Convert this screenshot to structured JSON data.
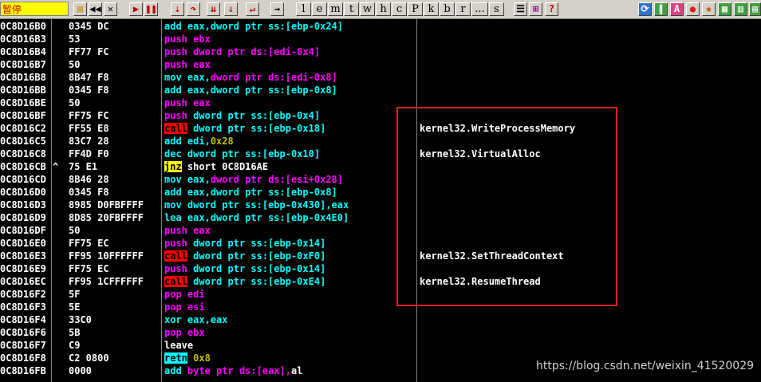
{
  "toolbar": {
    "status": "暂停",
    "letters": [
      "l",
      "e",
      "m",
      "t",
      "w",
      "h",
      "c",
      "P",
      "k",
      "b",
      "r",
      "...",
      "s"
    ],
    "help": "?",
    "icons": [
      "open-icon",
      "rewind-icon",
      "close-icon",
      "run-icon",
      "pause-icon",
      "step-into-icon",
      "step-over-icon",
      "trace-into-icon",
      "trace-over-icon",
      "execute-till-return-icon",
      "goto-icon",
      "list-icon",
      "windows-icon",
      "refresh-icon",
      "plugin-icon",
      "a-icon",
      "record-icon",
      "settings-icon",
      "grid-icon",
      "options-icon"
    ]
  },
  "rows": [
    {
      "addr": "0C8D16B0",
      "mark": "",
      "hex": "0345 DC",
      "mnem": "add",
      "kind": "k-mov",
      "ops": [
        [
          "eax,dword ptr ss:[ebp-0x24]",
          "op-cyan"
        ]
      ],
      "comment": ""
    },
    {
      "addr": "0C8D16B3",
      "mark": "",
      "hex": "53",
      "mnem": "push",
      "kind": "k-push",
      "ops": [
        [
          "ebx",
          "op-mag"
        ]
      ],
      "comment": ""
    },
    {
      "addr": "0C8D16B4",
      "mark": "",
      "hex": "FF77 FC",
      "mnem": "push",
      "kind": "k-push",
      "ops": [
        [
          "dword ptr ds:[edi-0x4]",
          "op-mag"
        ]
      ],
      "comment": ""
    },
    {
      "addr": "0C8D16B7",
      "mark": "",
      "hex": "50",
      "mnem": "push",
      "kind": "k-push",
      "ops": [
        [
          "eax",
          "op-mag"
        ]
      ],
      "comment": ""
    },
    {
      "addr": "0C8D16B8",
      "mark": "",
      "hex": "8B47 F8",
      "mnem": "mov",
      "kind": "k-mov",
      "ops": [
        [
          "eax,",
          "op-cyan"
        ],
        [
          "dword ptr ds:[edi-0x8]",
          "op-mag"
        ]
      ],
      "comment": ""
    },
    {
      "addr": "0C8D16BB",
      "mark": "",
      "hex": "0345 F8",
      "mnem": "add",
      "kind": "k-mov",
      "ops": [
        [
          "eax,dword ptr ss:[ebp-0x8]",
          "op-cyan"
        ]
      ],
      "comment": ""
    },
    {
      "addr": "0C8D16BE",
      "mark": "",
      "hex": "50",
      "mnem": "push",
      "kind": "k-push",
      "ops": [
        [
          "eax",
          "op-mag"
        ]
      ],
      "comment": ""
    },
    {
      "addr": "0C8D16BF",
      "mark": "",
      "hex": "FF75 FC",
      "mnem": "push",
      "kind": "k-push",
      "ops": [
        [
          "dword ptr ss:[ebp-0x4]",
          "op-cyan"
        ]
      ],
      "comment": ""
    },
    {
      "addr": "0C8D16C2",
      "mark": "",
      "hex": "FF55 E8",
      "mnem": "call",
      "kind": "k-call",
      "ops": [
        [
          "dword ptr ss:[ebp-0x18]",
          "op-cyan"
        ]
      ],
      "comment": "kernel32.WriteProcessMemory"
    },
    {
      "addr": "0C8D16C5",
      "mark": "",
      "hex": "83C7 28",
      "mnem": "add",
      "kind": "k-mov",
      "ops": [
        [
          "edi,",
          "op-cyan"
        ],
        [
          "0x28",
          "op-olive"
        ]
      ],
      "comment": ""
    },
    {
      "addr": "0C8D16C8",
      "mark": "",
      "hex": "FF4D F0",
      "mnem": "dec",
      "kind": "k-mov",
      "ops": [
        [
          "dword ptr ss:[ebp-0x10]",
          "op-cyan"
        ]
      ],
      "comment": "kernel32.VirtualAlloc"
    },
    {
      "addr": "0C8D16CB",
      "mark": "^",
      "hex": "75 E1",
      "mnem": "jnz",
      "kind": "k-jnz",
      "ops": [
        [
          "short 0C8D16AE",
          "op-white"
        ]
      ],
      "comment": ""
    },
    {
      "addr": "0C8D16CD",
      "mark": "",
      "hex": "8B46 28",
      "mnem": "mov",
      "kind": "k-mov",
      "ops": [
        [
          "eax,",
          "op-cyan"
        ],
        [
          "dword ptr ds:[esi+0x28]",
          "op-mag"
        ]
      ],
      "comment": ""
    },
    {
      "addr": "0C8D16D0",
      "mark": "",
      "hex": "0345 F8",
      "mnem": "add",
      "kind": "k-mov",
      "ops": [
        [
          "eax,dword ptr ss:[ebp-0x8]",
          "op-cyan"
        ]
      ],
      "comment": ""
    },
    {
      "addr": "0C8D16D3",
      "mark": "",
      "hex": "8985 D0FBFFFF",
      "mnem": "mov",
      "kind": "k-mov",
      "ops": [
        [
          "dword ptr ss:[ebp-0x430],eax",
          "op-cyan"
        ]
      ],
      "comment": ""
    },
    {
      "addr": "0C8D16D9",
      "mark": "",
      "hex": "8D85 20FBFFFF",
      "mnem": "lea",
      "kind": "k-mov",
      "ops": [
        [
          "eax,dword ptr ss:[ebp-0x4E0]",
          "op-cyan"
        ]
      ],
      "comment": ""
    },
    {
      "addr": "0C8D16DF",
      "mark": "",
      "hex": "50",
      "mnem": "push",
      "kind": "k-push",
      "ops": [
        [
          "eax",
          "op-mag"
        ]
      ],
      "comment": ""
    },
    {
      "addr": "0C8D16E0",
      "mark": "",
      "hex": "FF75 EC",
      "mnem": "push",
      "kind": "k-push",
      "ops": [
        [
          "dword ptr ss:[ebp-0x14]",
          "op-cyan"
        ]
      ],
      "comment": ""
    },
    {
      "addr": "0C8D16E3",
      "mark": "",
      "hex": "FF95 10FFFFFF",
      "mnem": "call",
      "kind": "k-call",
      "ops": [
        [
          "dword ptr ss:[ebp-0xF0]",
          "op-cyan"
        ]
      ],
      "comment": "kernel32.SetThreadContext"
    },
    {
      "addr": "0C8D16E9",
      "mark": "",
      "hex": "FF75 EC",
      "mnem": "push",
      "kind": "k-push",
      "ops": [
        [
          "dword ptr ss:[ebp-0x14]",
          "op-cyan"
        ]
      ],
      "comment": ""
    },
    {
      "addr": "0C8D16EC",
      "mark": "",
      "hex": "FF95 1CFFFFFF",
      "mnem": "call",
      "kind": "k-call",
      "ops": [
        [
          "dword ptr ss:[ebp-0xE4]",
          "op-cyan"
        ]
      ],
      "comment": "kernel32.ResumeThread"
    },
    {
      "addr": "0C8D16F2",
      "mark": "",
      "hex": "5F",
      "mnem": "pop",
      "kind": "k-push",
      "ops": [
        [
          "edi",
          "op-mag"
        ]
      ],
      "comment": ""
    },
    {
      "addr": "0C8D16F3",
      "mark": "",
      "hex": "5E",
      "mnem": "pop",
      "kind": "k-push",
      "ops": [
        [
          "esi",
          "op-mag"
        ]
      ],
      "comment": ""
    },
    {
      "addr": "0C8D16F4",
      "mark": "",
      "hex": "33C0",
      "mnem": "xor",
      "kind": "k-mov",
      "ops": [
        [
          "eax,eax",
          "op-cyan"
        ]
      ],
      "comment": ""
    },
    {
      "addr": "0C8D16F6",
      "mark": "",
      "hex": "5B",
      "mnem": "pop",
      "kind": "k-push",
      "ops": [
        [
          "ebx",
          "op-mag"
        ]
      ],
      "comment": ""
    },
    {
      "addr": "0C8D16F7",
      "mark": "",
      "hex": "C9",
      "mnem": "leave",
      "kind": "k-plain",
      "ops": [],
      "comment": ""
    },
    {
      "addr": "0C8D16F8",
      "mark": "",
      "hex": "C2 0800",
      "mnem": "retn",
      "kind": "k-retn",
      "ops": [
        [
          "0x8",
          "op-olive"
        ]
      ],
      "comment": ""
    },
    {
      "addr": "0C8D16FB",
      "mark": "",
      "hex": "0000",
      "mnem": "add",
      "kind": "k-mov",
      "ops": [
        [
          "byte ptr ds:[eax],",
          "op-mag"
        ],
        [
          "al",
          "op-white"
        ]
      ],
      "comment": ""
    }
  ],
  "watermark": "https://blog.csdn.net/weixin_41520029"
}
